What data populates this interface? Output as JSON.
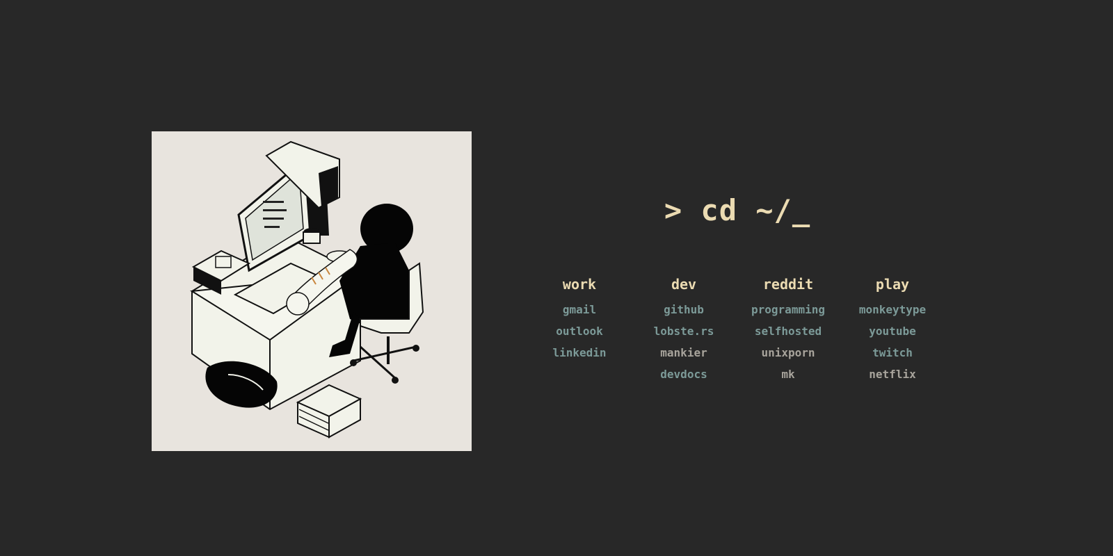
{
  "prompt": "> cd ~/_",
  "colors": {
    "background": "#282828",
    "accent": "#ebdbb2",
    "link": "#7c9a98",
    "link_muted": "#a8a49c",
    "illustration_bg": "#e8e4de"
  },
  "illustration": {
    "alt": "person-at-computer-desk-with-cat-illustration"
  },
  "columns": [
    {
      "title": "work",
      "links": [
        {
          "label": "gmail",
          "style": "teal"
        },
        {
          "label": "outlook",
          "style": "teal"
        },
        {
          "label": "linkedin",
          "style": "teal"
        }
      ]
    },
    {
      "title": "dev",
      "links": [
        {
          "label": "github",
          "style": "teal"
        },
        {
          "label": "lobste.rs",
          "style": "teal"
        },
        {
          "label": "mankier",
          "style": "grey"
        },
        {
          "label": "devdocs",
          "style": "teal"
        }
      ]
    },
    {
      "title": "reddit",
      "links": [
        {
          "label": "programming",
          "style": "teal"
        },
        {
          "label": "selfhosted",
          "style": "teal"
        },
        {
          "label": "unixporn",
          "style": "grey"
        },
        {
          "label": "mk",
          "style": "grey"
        }
      ]
    },
    {
      "title": "play",
      "links": [
        {
          "label": "monkeytype",
          "style": "teal"
        },
        {
          "label": "youtube",
          "style": "teal"
        },
        {
          "label": "twitch",
          "style": "teal"
        },
        {
          "label": "netflix",
          "style": "grey"
        }
      ]
    }
  ]
}
